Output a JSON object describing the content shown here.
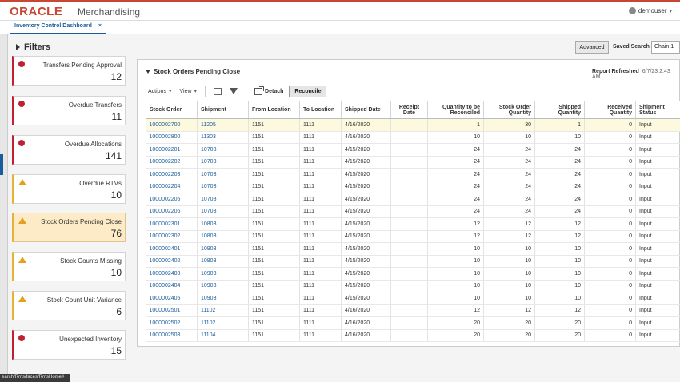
{
  "header": {
    "logo": "ORACLE",
    "app_name": "Merchandising",
    "user": "demouser"
  },
  "tab": {
    "label": "Inventory Control Dashboard",
    "close": "×"
  },
  "filters": {
    "title": "Filters"
  },
  "search": {
    "advanced": "Advanced",
    "saved_label": "Saved Search",
    "saved_value": "Chain 1"
  },
  "tiles": [
    {
      "label": "Transfers Pending Approval",
      "count": "12",
      "status": "error"
    },
    {
      "label": "Overdue Transfers",
      "count": "11",
      "status": "error"
    },
    {
      "label": "Overdue Allocations",
      "count": "141",
      "status": "error"
    },
    {
      "label": "Overdue RTVs",
      "count": "10",
      "status": "warning"
    },
    {
      "label": "Stock Orders Pending Close",
      "count": "76",
      "status": "warning"
    },
    {
      "label": "Stock Counts Missing",
      "count": "10",
      "status": "warning"
    },
    {
      "label": "Stock Count Unit Variance",
      "count": "6",
      "status": "warning"
    },
    {
      "label": "Unexpected Inventory",
      "count": "15",
      "status": "error"
    }
  ],
  "panel": {
    "title": "Stock Orders Pending Close",
    "refreshed_label": "Report Refreshed",
    "refreshed_value": "6/7/23 2:43 AM"
  },
  "toolbar": {
    "actions": "Actions",
    "view": "View",
    "detach": "Detach",
    "reconcile": "Reconcile"
  },
  "table": {
    "columns": [
      "Stock Order",
      "Shipment",
      "From Location",
      "To Location",
      "Shipped Date",
      "Receipt Date",
      "Quantity to be Reconciled",
      "Stock Order Quantity",
      "Shipped Quantity",
      "Received Quantity",
      "Shipment Status"
    ],
    "rows": [
      [
        "1000002700",
        "11205",
        "1151",
        "1111",
        "4/16/2020",
        "",
        "1",
        "30",
        "1",
        "0",
        "Input"
      ],
      [
        "1000002800",
        "11303",
        "1151",
        "1111",
        "4/16/2020",
        "",
        "10",
        "10",
        "10",
        "0",
        "Input"
      ],
      [
        "1000002201",
        "10703",
        "1151",
        "1111",
        "4/15/2020",
        "",
        "24",
        "24",
        "24",
        "0",
        "Input"
      ],
      [
        "1000002202",
        "10703",
        "1151",
        "1111",
        "4/15/2020",
        "",
        "24",
        "24",
        "24",
        "0",
        "Input"
      ],
      [
        "1000002203",
        "10703",
        "1151",
        "1111",
        "4/15/2020",
        "",
        "24",
        "24",
        "24",
        "0",
        "Input"
      ],
      [
        "1000002204",
        "10703",
        "1151",
        "1111",
        "4/15/2020",
        "",
        "24",
        "24",
        "24",
        "0",
        "Input"
      ],
      [
        "1000002205",
        "10703",
        "1151",
        "1111",
        "4/15/2020",
        "",
        "24",
        "24",
        "24",
        "0",
        "Input"
      ],
      [
        "1000002206",
        "10703",
        "1151",
        "1111",
        "4/15/2020",
        "",
        "24",
        "24",
        "24",
        "0",
        "Input"
      ],
      [
        "1000002301",
        "10803",
        "1151",
        "1111",
        "4/15/2020",
        "",
        "12",
        "12",
        "12",
        "0",
        "Input"
      ],
      [
        "1000002302",
        "10803",
        "1151",
        "1111",
        "4/15/2020",
        "",
        "12",
        "12",
        "12",
        "0",
        "Input"
      ],
      [
        "1000002401",
        "10903",
        "1151",
        "1111",
        "4/15/2020",
        "",
        "10",
        "10",
        "10",
        "0",
        "Input"
      ],
      [
        "1000002402",
        "10903",
        "1151",
        "1111",
        "4/15/2020",
        "",
        "10",
        "10",
        "10",
        "0",
        "Input"
      ],
      [
        "1000002403",
        "10903",
        "1151",
        "1111",
        "4/15/2020",
        "",
        "10",
        "10",
        "10",
        "0",
        "Input"
      ],
      [
        "1000002404",
        "10903",
        "1151",
        "1111",
        "4/15/2020",
        "",
        "10",
        "10",
        "10",
        "0",
        "Input"
      ],
      [
        "1000002405",
        "10903",
        "1151",
        "1111",
        "4/15/2020",
        "",
        "10",
        "10",
        "10",
        "0",
        "Input"
      ],
      [
        "1000002501",
        "11102",
        "1151",
        "1111",
        "4/16/2020",
        "",
        "12",
        "12",
        "12",
        "0",
        "Input"
      ],
      [
        "1000002502",
        "11102",
        "1151",
        "1111",
        "4/16/2020",
        "",
        "20",
        "20",
        "20",
        "0",
        "Input"
      ],
      [
        "1000002503",
        "11104",
        "1151",
        "1111",
        "4/16/2020",
        "",
        "20",
        "20",
        "20",
        "0",
        "Input"
      ]
    ]
  },
  "status_url": "earch/Rms/faces/RmsHome#",
  "colors": {
    "oracle_red": "#c74634",
    "link_blue": "#1a5d9a",
    "error_red": "#c02032",
    "warning_amber": "#e6a11c"
  }
}
